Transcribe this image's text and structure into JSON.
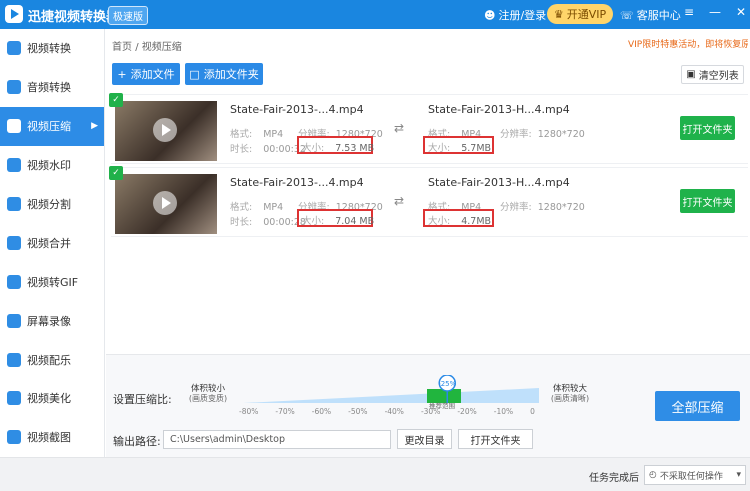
{
  "app": {
    "title": "迅捷视频转换器",
    "edition": "极速版"
  },
  "header": {
    "user_label": "注册/登录",
    "vip_label": "开通VIP",
    "service_label": "客服中心"
  },
  "sidebar": {
    "items": [
      {
        "label": "视频转换",
        "icon": "video-convert-icon"
      },
      {
        "label": "音频转换",
        "icon": "audio-convert-icon"
      },
      {
        "label": "视频压缩",
        "icon": "video-compress-icon",
        "active": true
      },
      {
        "label": "视频水印",
        "icon": "watermark-icon"
      },
      {
        "label": "视频分割",
        "icon": "split-icon"
      },
      {
        "label": "视频合并",
        "icon": "merge-icon"
      },
      {
        "label": "视频转GIF",
        "icon": "gif-icon"
      },
      {
        "label": "屏幕录像",
        "icon": "screen-record-icon"
      },
      {
        "label": "视频配乐",
        "icon": "music-icon"
      },
      {
        "label": "视频美化",
        "icon": "beautify-icon"
      },
      {
        "label": "视频截图",
        "icon": "screenshot-icon"
      }
    ]
  },
  "breadcrumb": {
    "home": "首页",
    "sep": "/",
    "current": "视频压缩"
  },
  "promo": "VIP限时特惠活动，即将恢复原价",
  "toolbar": {
    "add_file": "添加文件",
    "add_folder": "添加文件夹",
    "clear_list": "清空列表"
  },
  "files": [
    {
      "src_name": "State-Fair-2013-...4.mp4",
      "src_format": "MP4",
      "src_duration": "00:00:32",
      "src_resolution": "1280*720",
      "src_size": "7.53 MB",
      "out_name": "State-Fair-2013-H...4.mp4",
      "out_format": "MP4",
      "out_resolution": "1280*720",
      "out_size": "5.7MB",
      "open_label": "打开文件夹"
    },
    {
      "src_name": "State-Fair-2013-...4.mp4",
      "src_format": "MP4",
      "src_duration": "00:00:28",
      "src_resolution": "1280*720",
      "src_size": "7.04 MB",
      "out_name": "State-Fair-2013-H...4.mp4",
      "out_format": "MP4",
      "out_resolution": "1280*720",
      "out_size": "4.7MB",
      "open_label": "打开文件夹"
    }
  ],
  "labels": {
    "format": "格式:",
    "duration": "时长:",
    "resolution": "分辨率:",
    "size": "大小:"
  },
  "compress": {
    "ratio_label": "设置压缩比:",
    "small_title": "体积较小",
    "small_sub": "(画质变质)",
    "large_title": "体积较大",
    "large_sub": "(画质清晰)",
    "value_label": "-25%",
    "value_fraction": 0.69,
    "recommend": "推荐范围",
    "ticks": [
      "-80%",
      "-70%",
      "-60%",
      "-50%",
      "-40%",
      "-30%",
      "-20%",
      "-10%",
      "0"
    ]
  },
  "output": {
    "label": "输出路径:",
    "path": "C:\\Users\\admin\\Desktop",
    "change_dir": "更改目录",
    "open_folder": "打开文件夹"
  },
  "compress_all": "全部压缩",
  "status": {
    "done_label": "任务完成后",
    "done_value": "不采取任何操作"
  },
  "colors": {
    "primary": "#2b8ae6",
    "green": "#1fb24b",
    "highlight": "#d33"
  }
}
